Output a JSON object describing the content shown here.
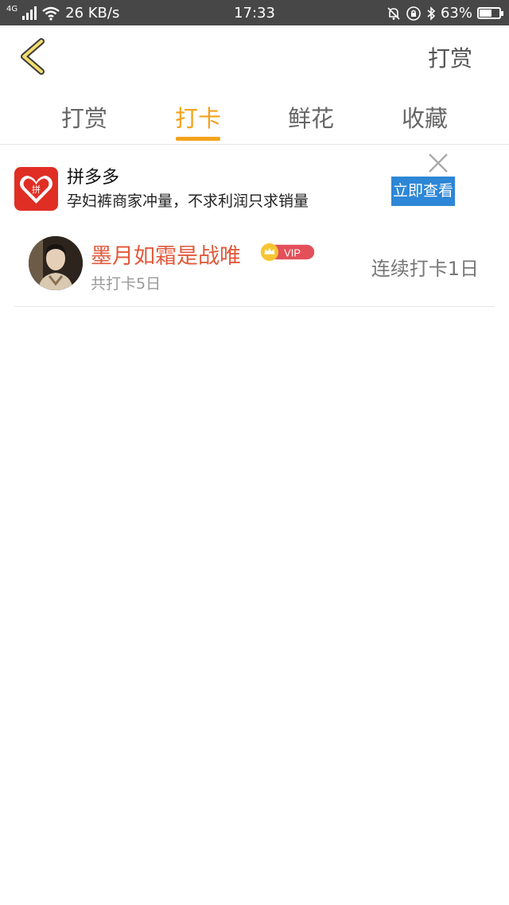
{
  "status_bar": {
    "network": "4G",
    "speed": "26 KB/s",
    "time": "17:33",
    "battery": "63%",
    "battery_level": 0.63
  },
  "nav": {
    "action_label": "打赏"
  },
  "tabs": [
    {
      "label": "打赏",
      "active": false
    },
    {
      "label": "打卡",
      "active": true
    },
    {
      "label": "鲜花",
      "active": false
    },
    {
      "label": "收藏",
      "active": false
    }
  ],
  "ad": {
    "brand": "拼多多",
    "description": "孕妇裤商家冲量，不求利润只求销量",
    "cta": "立即查看",
    "logo_glyph": "拼"
  },
  "records": [
    {
      "name": "墨月如霜是战唯",
      "badge": "VIP",
      "total": "共打卡5日",
      "streak": "连续打卡1日"
    }
  ],
  "colors": {
    "accent": "#f4a21c",
    "username": "#e25a3c",
    "ad_button": "#2d87d6",
    "ad_logo": "#e02e24"
  }
}
